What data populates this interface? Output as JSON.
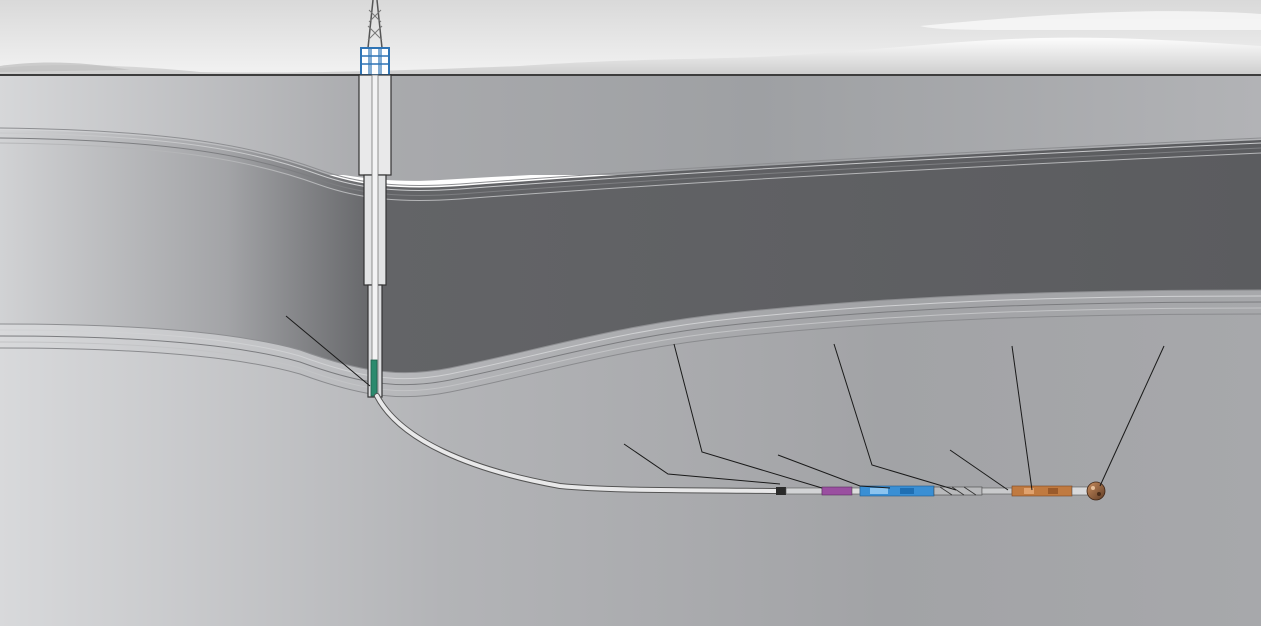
{
  "diagram": {
    "title": "",
    "components": [
      "drilling-rig",
      "surface-casing",
      "intermediate-casing",
      "kickoff-point",
      "curved-wellbore",
      "lateral-section",
      "drill-pipe-joint",
      "mwd-tool",
      "mud-motor",
      "stabilizer",
      "bit-sub",
      "drill-bit"
    ],
    "callout_count": 9,
    "callout_labels": []
  },
  "colors": {
    "sky": "#e6e6e6",
    "ground_surface": "#4d4d4d",
    "upper_formation": "#a7a8ab",
    "shale_layer": "#5c5d60",
    "reservoir": "#a4a5a8",
    "wellbore": "#cfd0d2",
    "casing_blue": "#2f74b5",
    "mwd_purple": "#9a4fa0",
    "motor_blue": "#3a8fd4",
    "sub_copper": "#c07a40",
    "bit_brown": "#8a5a3a",
    "leader_line": "#1a1a1a"
  }
}
